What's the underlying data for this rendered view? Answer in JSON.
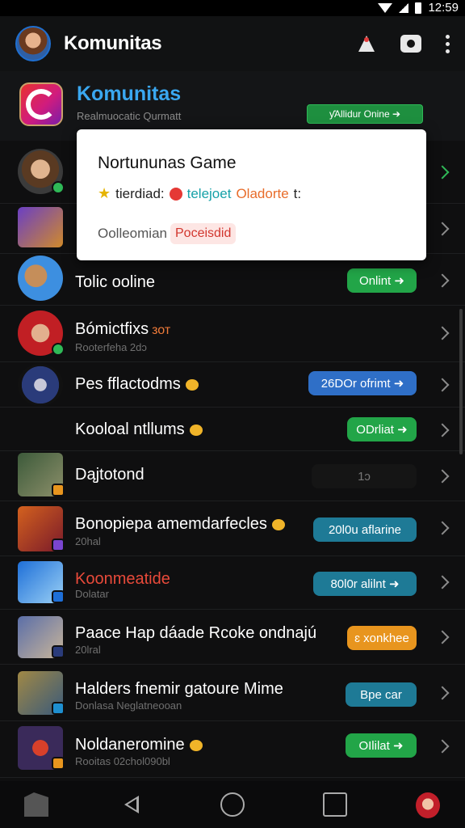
{
  "status_bar": {
    "time": "12:59"
  },
  "app_bar": {
    "title": "Komunitas"
  },
  "header": {
    "title": "Komunitas",
    "subtitle": "Realmuocatic Qurmatt",
    "button_label": "ƴAllidur Onine ➔"
  },
  "popup": {
    "title": "Nortununas Game",
    "line_prefix": "tierdiad:",
    "line_teal": "telejoet",
    "line_orange": "Oladorte",
    "line_suffix": "t:",
    "foot_label": "Oolleomian",
    "foot_chip": "Poceisdid"
  },
  "rows": [
    {
      "name": "",
      "sub": "",
      "pill": ""
    },
    {
      "name": "",
      "sub": "",
      "pill": ""
    },
    {
      "name": "Tolic ooline",
      "sub": "",
      "pill": "Onlint ➜"
    },
    {
      "name": "Bómictfixs",
      "tag": "зот",
      "sub": "Rooterfeha 2dɔ",
      "pill": ""
    },
    {
      "name": "Pes fflactodms",
      "sub": "",
      "pill": "26DOr ofrimt ➜"
    },
    {
      "name": "Kooloal ntllums",
      "sub": "",
      "pill": "ODrliat ➜"
    },
    {
      "name": "Dąjtotond",
      "sub": "",
      "pill": "1ɔ"
    },
    {
      "name": "Bonopiepa amemdarfecles",
      "sub": "20hal",
      "pill": "20l0u aflarine"
    },
    {
      "name": "Koonmeatide",
      "sub": "Dolatar",
      "pill": "80l0r alilnt ➜"
    },
    {
      "name": "Paace Hap dáade Rcoke ondnajú",
      "sub": "20lral",
      "pill": "ɛ xonkhee"
    },
    {
      "name": "Halders fnemir gatoure Mime",
      "sub": "Donlasa Neglatneooan",
      "pill": "Bpe car"
    },
    {
      "name": "Noldaneromine",
      "sub": "Rooitas 02chol090bl",
      "pill": "OIlilat ➜"
    }
  ],
  "colors": {
    "accent_blue": "#3aa7f0",
    "online_green": "#22a548",
    "pill_blue": "#2f6fc7",
    "pill_teal": "#1e7a96",
    "pill_orange": "#e8951e",
    "name_red": "#e84a3a"
  }
}
